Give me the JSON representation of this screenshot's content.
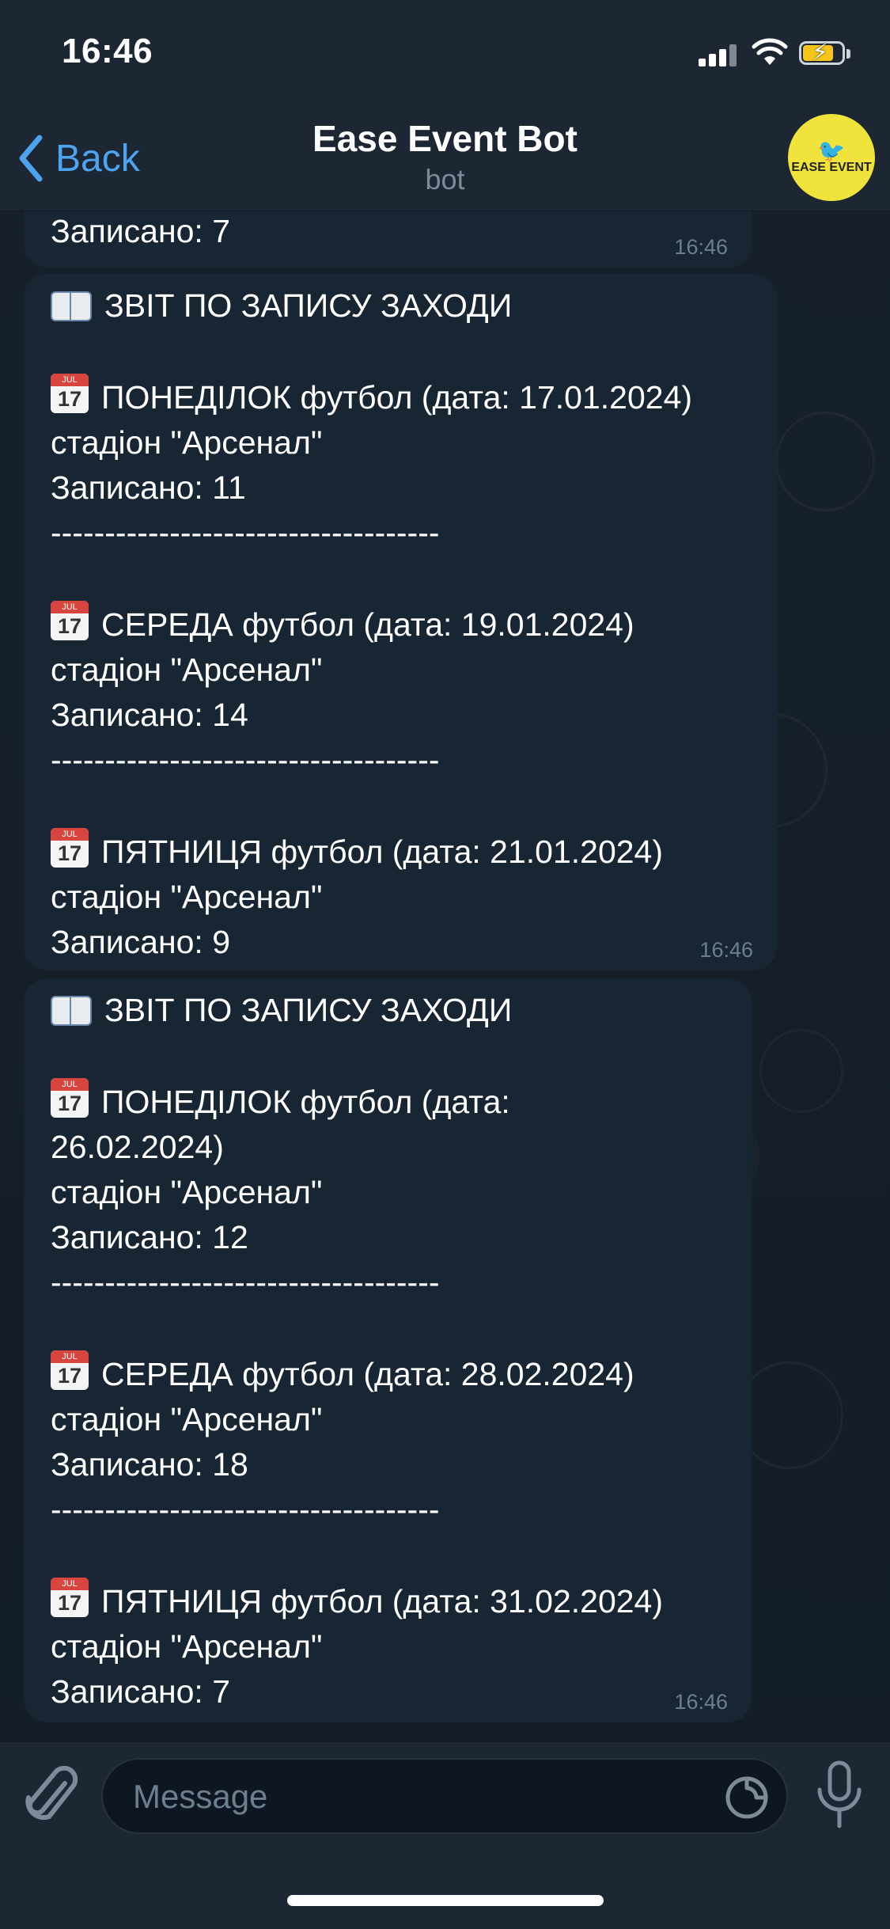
{
  "status": {
    "time": "16:46"
  },
  "nav": {
    "back_label": "Back",
    "title": "Ease Event Bot",
    "subtitle": "bot",
    "avatar_text": "EASE EVENT"
  },
  "messages": [
    {
      "lines": [
        "Записано: 7"
      ],
      "time": "16:46"
    },
    {
      "header": "ЗВІТ ПО ЗАПИСУ ЗАХОДИ",
      "events": [
        {
          "title": "ПОНЕДІЛОК футбол (дата: 17.01.2024)",
          "place": "стадіон \"Арсенал\"",
          "count": "Записано: 11"
        },
        {
          "title": "СЕРЕДА футбол (дата: 19.01.2024)",
          "place": "стадіон \"Арсенал\"",
          "count": "Записано: 14"
        },
        {
          "title": "ПЯТНИЦЯ футбол (дата: 21.01.2024)",
          "place": "стадіон \"Арсенал\"",
          "count": "Записано: 9"
        }
      ],
      "separator": "------------------------------------",
      "time": "16:46"
    },
    {
      "header": "ЗВІТ ПО ЗАПИСУ ЗАХОДИ",
      "events": [
        {
          "title": "ПОНЕДІЛОК футбол (дата:",
          "title2": "26.02.2024)",
          "place": "стадіон \"Арсенал\"",
          "count": "Записано: 12"
        },
        {
          "title": "СЕРЕДА футбол (дата: 28.02.2024)",
          "place": "стадіон \"Арсенал\"",
          "count": "Записано: 18"
        },
        {
          "title": "ПЯТНИЦЯ футбол (дата: 31.02.2024)",
          "place": "стадіон \"Арсенал\"",
          "count": "Записано: 7"
        }
      ],
      "separator": "------------------------------------",
      "time": "16:46"
    }
  ],
  "composer": {
    "placeholder": "Message"
  },
  "icons": {
    "back": "chevron-left-icon",
    "attach": "paperclip-icon",
    "sticker": "sticker-icon",
    "mic": "microphone-icon",
    "book": "open-book-icon",
    "calendar": "calendar-icon"
  },
  "colors": {
    "accent": "#4da3f0",
    "bubble": "#182533",
    "bar": "#1c2733",
    "avatar": "#f0e33b"
  }
}
